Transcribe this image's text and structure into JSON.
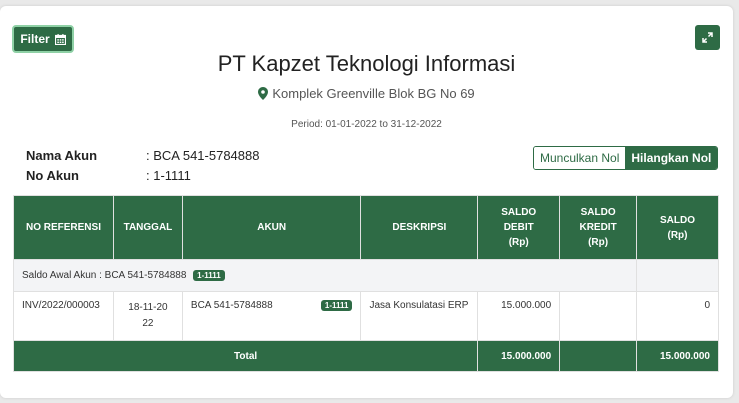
{
  "filter_label": "Filter",
  "company_name": "PT Kapzet Teknologi Informasi",
  "address": "Komplek Greenville Blok BG No 69",
  "period": "Period: 01-01-2022 to 31-12-2022",
  "account": {
    "name_label": "Nama Akun",
    "name_value": ": BCA 541-5784888",
    "no_label": "No Akun",
    "no_value": ": 1-1111"
  },
  "toggle": {
    "show_zero": "Munculkan Nol",
    "hide_zero": "Hilangkan Nol"
  },
  "table": {
    "headers": [
      "NO REFERENSI",
      "TANGGAL",
      "AKUN",
      "DESKRIPSI",
      "SALDO DEBIT (Rp)",
      "SALDO KREDIT (Rp)",
      "SALDO (Rp)"
    ],
    "opening_label": "Saldo Awal Akun : BCA 541-5784888",
    "opening_badge": "1-1111",
    "rows": [
      {
        "ref": "INV/2022/000003",
        "date": "18-11-2022",
        "account": "BCA 541-5784888",
        "account_badge": "1-1111",
        "description": "Jasa Konsulatasi ERP",
        "debit": "15.000.000",
        "credit": "",
        "balance": "0"
      }
    ],
    "total_label": "Total",
    "total_debit": "15.000.000",
    "total_credit": "",
    "total_balance": "15.000.000"
  },
  "colors": {
    "primary": "#2e6b45",
    "header_text": "#ffffff",
    "row_shade": "#f3f4f6"
  },
  "icons": {
    "filter": "calendar-icon",
    "expand": "expand-icon",
    "address": "map-marker-icon"
  }
}
